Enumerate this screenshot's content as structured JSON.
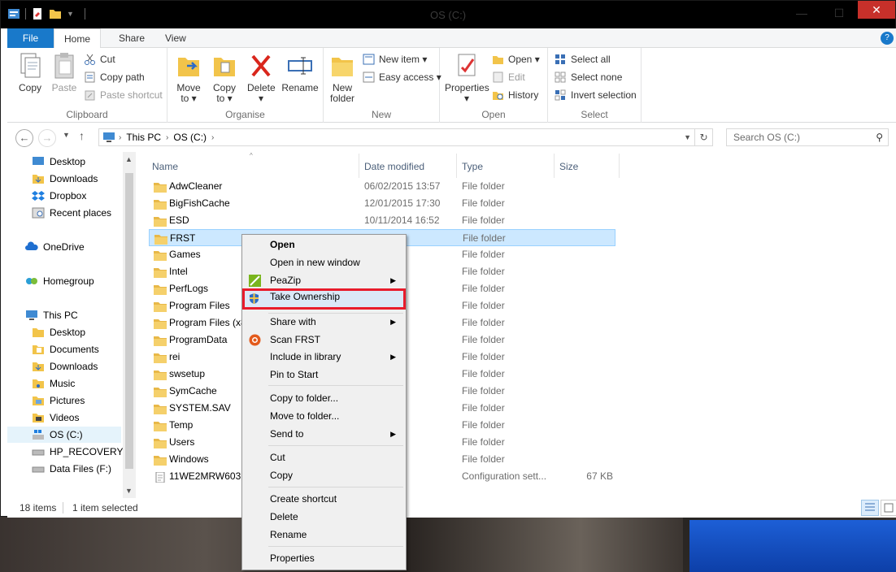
{
  "window": {
    "title": "OS (C:)"
  },
  "ribbon_tabs": {
    "file": "File",
    "home": "Home",
    "share": "Share",
    "view": "View"
  },
  "ribbon": {
    "clipboard": {
      "label": "Clipboard",
      "copy": "Copy",
      "paste": "Paste",
      "cut": "Cut",
      "copy_path": "Copy path",
      "paste_shortcut": "Paste shortcut"
    },
    "organise": {
      "label": "Organise",
      "move_to": "Move",
      "move_to_2": "to ▾",
      "copy_to": "Copy",
      "copy_to_2": "to ▾",
      "delete": "Delete",
      "delete_2": "▾",
      "rename": "Rename"
    },
    "new": {
      "label": "New",
      "new_folder": "New",
      "new_folder_2": "folder",
      "new_item": "New item ▾",
      "easy_access": "Easy access ▾"
    },
    "open": {
      "label": "Open",
      "properties": "Properties",
      "properties_2": "▾",
      "open": "Open ▾",
      "edit": "Edit",
      "history": "History"
    },
    "select": {
      "label": "Select",
      "select_all": "Select all",
      "select_none": "Select none",
      "invert": "Invert selection"
    }
  },
  "address": {
    "crumbs": [
      "This PC",
      "OS (C:)"
    ],
    "search_placeholder": "Search OS (C:)"
  },
  "nav": {
    "items": [
      {
        "label": "Desktop"
      },
      {
        "label": "Downloads"
      },
      {
        "label": "Dropbox"
      },
      {
        "label": "Recent places"
      },
      {
        "label": "OneDrive"
      },
      {
        "label": "Homegroup"
      },
      {
        "label": "This PC"
      },
      {
        "label": "Desktop"
      },
      {
        "label": "Documents"
      },
      {
        "label": "Downloads"
      },
      {
        "label": "Music"
      },
      {
        "label": "Pictures"
      },
      {
        "label": "Videos"
      },
      {
        "label": "OS (C:)"
      },
      {
        "label": "HP_RECOVERY (D"
      },
      {
        "label": "Data Files (F:)"
      }
    ]
  },
  "columns": {
    "name": "Name",
    "date": "Date modified",
    "type": "Type",
    "size": "Size"
  },
  "files": [
    {
      "name": "AdwCleaner",
      "date": "06/02/2015 13:57",
      "type": "File folder",
      "size": ""
    },
    {
      "name": "BigFishCache",
      "date": "12/01/2015 17:30",
      "type": "File folder",
      "size": ""
    },
    {
      "name": "ESD",
      "date": "10/11/2014 16:52",
      "type": "File folder",
      "size": ""
    },
    {
      "name": "FRST",
      "date": "5 13:12",
      "type": "File folder",
      "size": ""
    },
    {
      "name": "Games",
      "date": "5 17:54",
      "type": "File folder",
      "size": ""
    },
    {
      "name": "Intel",
      "date": "3 20:46",
      "type": "File folder",
      "size": ""
    },
    {
      "name": "PerfLogs",
      "date": "3 16:22",
      "type": "File folder",
      "size": ""
    },
    {
      "name": "Program Files",
      "date": "5 11:52",
      "type": "File folder",
      "size": ""
    },
    {
      "name": "Program Files (x8",
      "date": "5 11:52",
      "type": "File folder",
      "size": ""
    },
    {
      "name": "ProgramData",
      "date": "5 11:52",
      "type": "File folder",
      "size": ""
    },
    {
      "name": "rei",
      "date": "3 19:53",
      "type": "File folder",
      "size": ""
    },
    {
      "name": "swsetup",
      "date": "5 12:06",
      "type": "File folder",
      "size": ""
    },
    {
      "name": "SymCache",
      "date": "5 17:38",
      "type": "File folder",
      "size": ""
    },
    {
      "name": "SYSTEM.SAV",
      "date": "3 14:48",
      "type": "File folder",
      "size": ""
    },
    {
      "name": "Temp",
      "date": "4 18:40",
      "type": "File folder",
      "size": ""
    },
    {
      "name": "Users",
      "date": "4 16:12",
      "type": "File folder",
      "size": ""
    },
    {
      "name": "Windows",
      "date": "5 13:11",
      "type": "File folder",
      "size": ""
    },
    {
      "name": "11WE2MRW603",
      "date": "1 11:12",
      "type": "Configuration sett...",
      "size": "67 KB"
    }
  ],
  "status": {
    "items": "18 items",
    "selected": "1 item selected"
  },
  "context_menu": {
    "open": "Open",
    "open_new_window": "Open in new window",
    "peazip": "PeaZip",
    "take_ownership": "Take Ownership",
    "share_with": "Share with",
    "scan_frst": "Scan FRST",
    "include_in_library": "Include in library",
    "pin_to_start": "Pin to Start",
    "copy_to_folder": "Copy to folder...",
    "move_to_folder": "Move to folder...",
    "send_to": "Send to",
    "cut": "Cut",
    "copy": "Copy",
    "create_shortcut": "Create shortcut",
    "delete": "Delete",
    "rename": "Rename",
    "properties": "Properties"
  },
  "colors": {
    "accent": "#1979ca",
    "selection": "#cce8ff",
    "highlight_border": "#e81c2c",
    "folder": "#e8b848"
  }
}
